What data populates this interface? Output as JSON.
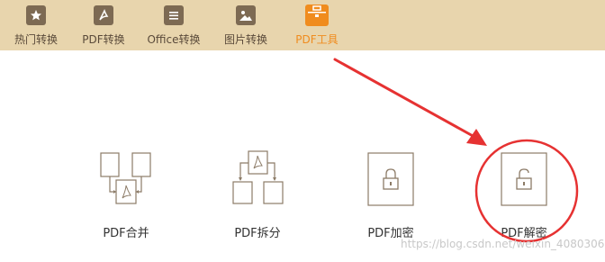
{
  "tabs": [
    {
      "label": "热门转换",
      "icon": "star-icon"
    },
    {
      "label": "PDF转换",
      "icon": "pdf-file-icon"
    },
    {
      "label": "Office转换",
      "icon": "document-icon"
    },
    {
      "label": "图片转换",
      "icon": "image-icon"
    },
    {
      "label": "PDF工具",
      "icon": "toolbox-icon",
      "active": true
    }
  ],
  "tools": [
    {
      "label": "PDF合并",
      "icon": "merge-icon"
    },
    {
      "label": "PDF拆分",
      "icon": "split-icon"
    },
    {
      "label": "PDF加密",
      "icon": "lock-icon"
    },
    {
      "label": "PDF解密",
      "icon": "unlock-icon"
    }
  ],
  "watermark": "https://blog.csdn.net/weixin_4080306",
  "colors": {
    "topbar": "#e8d5ad",
    "tab_icon": "#7d6a53",
    "active": "#f08c1e",
    "annotation": "#e63232",
    "line": "#8c7b67"
  }
}
